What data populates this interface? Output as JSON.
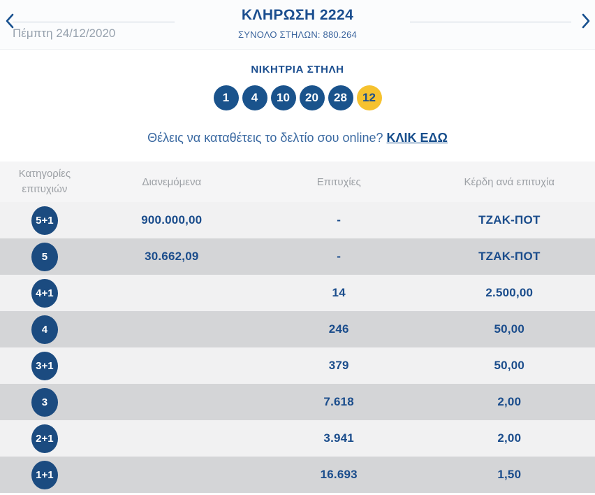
{
  "header": {
    "prev_icon": "chevron-left",
    "next_icon": "chevron-right",
    "date": "Πέμπτη 24/12/2020",
    "title": "ΚΛΗΡΩΣΗ 2224",
    "subtitle": "ΣΥΝΟΛΟ ΣΤΗΛΩΝ: 880.264"
  },
  "winning": {
    "heading": "ΝΙΚΗΤΡΙΑ ΣΤΗΛΗ",
    "numbers": [
      {
        "value": "1",
        "type": "main"
      },
      {
        "value": "4",
        "type": "main"
      },
      {
        "value": "10",
        "type": "main"
      },
      {
        "value": "20",
        "type": "main"
      },
      {
        "value": "28",
        "type": "main"
      },
      {
        "value": "12",
        "type": "joker"
      }
    ],
    "cta_text": "Θέλεις να καταθέτεις το δελτίο σου online?",
    "cta_link": "ΚΛΙΚ ΕΔΩ"
  },
  "table": {
    "columns": {
      "categories": "Κατηγορίες επιτυχιών",
      "distributed": "Διανεμόμενα",
      "winners": "Επιτυχίες",
      "prize_per_win": "Κέρδη ανά επιτυχία"
    },
    "rows": [
      {
        "category": "5+1",
        "distributed": "900.000,00",
        "winners": "-",
        "prize": "ΤΖΑΚ-ΠΟΤ"
      },
      {
        "category": "5",
        "distributed": "30.662,09",
        "winners": "-",
        "prize": "ΤΖΑΚ-ΠΟΤ"
      },
      {
        "category": "4+1",
        "distributed": "",
        "winners": "14",
        "prize": "2.500,00"
      },
      {
        "category": "4",
        "distributed": "",
        "winners": "246",
        "prize": "50,00"
      },
      {
        "category": "3+1",
        "distributed": "",
        "winners": "379",
        "prize": "50,00"
      },
      {
        "category": "3",
        "distributed": "",
        "winners": "7.618",
        "prize": "2,00"
      },
      {
        "category": "2+1",
        "distributed": "",
        "winners": "3.941",
        "prize": "2,00"
      },
      {
        "category": "1+1",
        "distributed": "",
        "winners": "16.693",
        "prize": "1,50"
      }
    ]
  },
  "colors": {
    "navy": "#1b4e8f",
    "ball_navy": "#1a538c",
    "badge_navy": "#1b4b80",
    "joker_yellow": "#f6c22f",
    "row_light": "#f1f1f2",
    "row_dark": "#d4d5d7",
    "table_header_bg": "#f5f5f6",
    "table_header_text": "#9ca0a5",
    "date_gray": "#97a2ae",
    "separator_line": "#c9d2dc"
  }
}
